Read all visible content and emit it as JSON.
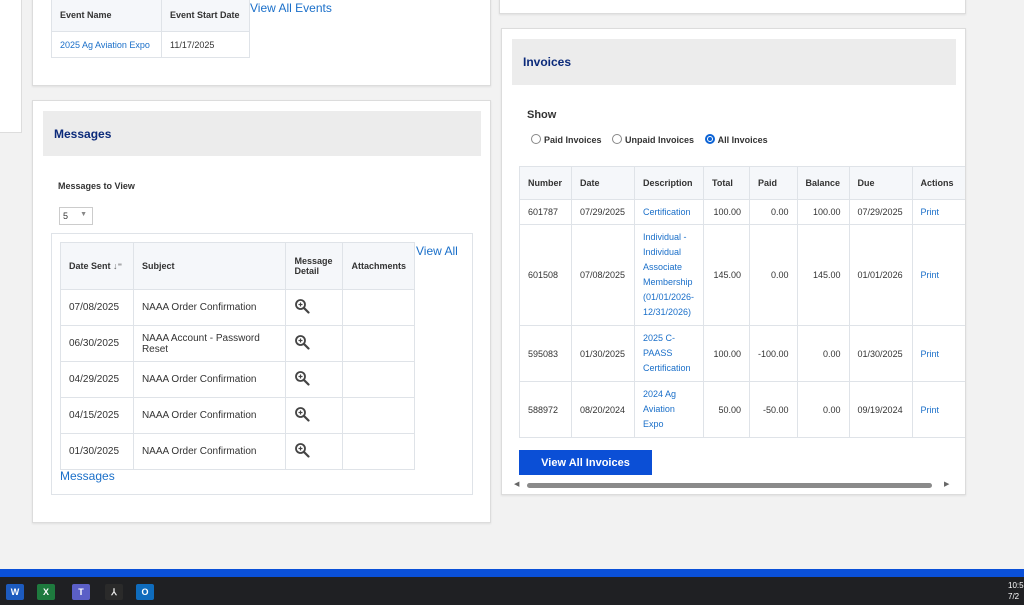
{
  "events": {
    "columns": [
      "Event Name",
      "Event Start Date"
    ],
    "rows": [
      {
        "name": "2025 Ag Aviation Expo",
        "date": "11/17/2025"
      }
    ],
    "view_all": "View All Events"
  },
  "messages": {
    "title": "Messages",
    "filter_label": "Messages to View",
    "count_value": "5",
    "columns": {
      "date": "Date Sent",
      "subject": "Subject",
      "detail": "Message Detail",
      "attachments": "Attachments"
    },
    "view_all": "View All",
    "footer_link": "Messages",
    "rows": [
      {
        "date": "07/08/2025",
        "subject": "NAAA Order Confirmation"
      },
      {
        "date": "06/30/2025",
        "subject": "NAAA Account - Password Reset"
      },
      {
        "date": "04/29/2025",
        "subject": "NAAA Order Confirmation"
      },
      {
        "date": "04/15/2025",
        "subject": "NAAA Order Confirmation"
      },
      {
        "date": "01/30/2025",
        "subject": "NAAA Order Confirmation"
      }
    ]
  },
  "invoices": {
    "title": "Invoices",
    "show_label": "Show",
    "filters": [
      {
        "label": "Paid Invoices",
        "selected": false
      },
      {
        "label": "Unpaid Invoices",
        "selected": false
      },
      {
        "label": "All Invoices",
        "selected": true
      }
    ],
    "columns": [
      "Number",
      "Date",
      "Description",
      "Total",
      "Paid",
      "Balance",
      "Due",
      "Actions"
    ],
    "rows": [
      {
        "number": "601787",
        "date": "07/29/2025",
        "description": [
          "Certification"
        ],
        "total": "100.00",
        "paid": "0.00",
        "balance": "100.00",
        "due": "07/29/2025",
        "action": "Print"
      },
      {
        "number": "601508",
        "date": "07/08/2025",
        "description": [
          "Individual -",
          "Individual",
          "Associate",
          "Membership",
          "(01/01/2026-",
          "12/31/2026)"
        ],
        "total": "145.00",
        "paid": "0.00",
        "balance": "145.00",
        "due": "01/01/2026",
        "action": "Print"
      },
      {
        "number": "595083",
        "date": "01/30/2025",
        "description": [
          "2025 C-",
          "PAASS",
          "Certification"
        ],
        "total": "100.00",
        "paid": "-100.00",
        "balance": "0.00",
        "due": "01/30/2025",
        "action": "Print"
      },
      {
        "number": "588972",
        "date": "08/20/2024",
        "description": [
          "2024 Ag",
          "Aviation",
          "Expo"
        ],
        "total": "50.00",
        "paid": "-50.00",
        "balance": "0.00",
        "due": "09/19/2024",
        "action": "Print"
      }
    ],
    "view_all_button": "View All Invoices"
  },
  "taskbar": {
    "apps": [
      "word-icon",
      "excel-icon",
      "teams-icon",
      "acrobat-icon",
      "outlook-icon"
    ],
    "clock_time": "10:5",
    "clock_date": "7/2"
  },
  "colors": {
    "accent": "#0b4fd6",
    "link": "#1a6fc9",
    "heading": "#0b2a7a"
  }
}
